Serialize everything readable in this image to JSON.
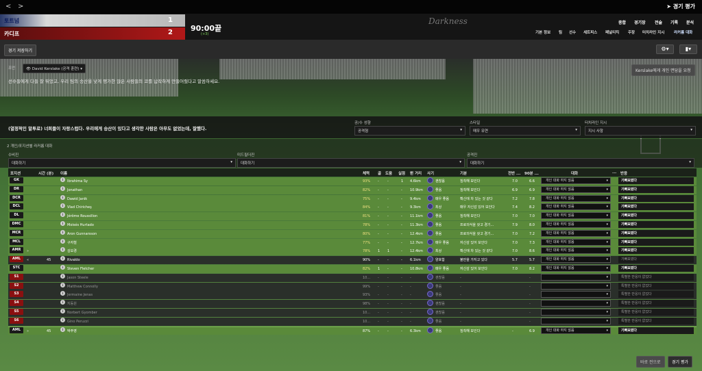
{
  "nav": {
    "back": "<",
    "forward": ">",
    "title": "경기 평가"
  },
  "teams": [
    {
      "name": "토트넘",
      "score": "1"
    },
    {
      "name": "카디프",
      "score": "2"
    }
  ],
  "match": {
    "time": "90:00끝",
    "added": "(+3)"
  },
  "logo": "Darkness",
  "menu": [
    "종합",
    "경기장",
    "전술",
    "기록",
    "분석"
  ],
  "submenu": [
    "기본 정보",
    "팀",
    "선수",
    "세트피스",
    "페널티킥",
    "주장",
    "터치라인 지시",
    "라커룸 대화"
  ],
  "save_btn": "경기 저장하기",
  "advisor": {
    "label": "조언",
    "name": "David Kerslake (공격 훈련)",
    "text": "선수들에게 다들 잘 뛰었고, 우리 팀의 승산을 낮게 평가한 많은 사람들의 코를 납작하게 만들어줬다고 말씀하세요.",
    "btn": "Kerslake에게 개인 면담을 요청"
  },
  "team_talk": {
    "text": "(열정적인 말투로) 너희들이 자랑스럽다. 우리에게 승산이 있다고 생각한 사람은 아무도 없었는데, 잘했다.",
    "attack_label": "공/수 성향",
    "attack_val": "공격형",
    "style_label": "스타일",
    "style_val": "매우 유연",
    "touch_label": "터치라인 지시",
    "touch_val": "지시 사항"
  },
  "section": {
    "title": "2  개인/포지션별 라커룸 대화",
    "def_label": "수비진",
    "def_val": "대화하기",
    "mid_label": "미드필더진",
    "mid_val": "대화하기",
    "att_label": "공격진",
    "att_val": "대화하기"
  },
  "columns": {
    "pos": "포지션",
    "time": "시간 (분)",
    "name": "이름",
    "cond": "체력",
    "g": "골",
    "a": "도움",
    "sh": "실점",
    "dist": "뛴 거리",
    "mor": "사기",
    "mood": "기분",
    "rbef": "전반 ...",
    "r90": "90분 ...",
    "talk": "대화",
    "dots": "...",
    "resp": "반응"
  },
  "rows": [
    {
      "pos": "GK",
      "t": "",
      "arrow": "",
      "name": "Ibrahima Sy",
      "cond": "93%",
      "g": "-",
      "a": "-",
      "sh": "1",
      "dist": "4.6km",
      "mor": "괜찮음",
      "mood": "침착해 보인다",
      "rb": "7.0",
      "r9": "6.6",
      "talk": "개인 대화 하지 않음",
      "resp": "기뻐보였다",
      "type": "g"
    },
    {
      "pos": "DR",
      "t": "",
      "arrow": "",
      "name": "Jonathan",
      "cond": "82%",
      "g": "-",
      "a": "-",
      "sh": "-",
      "dist": "10.9km",
      "mor": "좋음",
      "mood": "침착해 보인다",
      "rb": "6.9",
      "r9": "6.9",
      "talk": "개인 대화 하지 않음",
      "resp": "기뻐보였다",
      "type": "g"
    },
    {
      "pos": "DCR",
      "t": "",
      "arrow": "",
      "name": "Dawid Janik",
      "cond": "75%",
      "g": "-",
      "a": "-",
      "sh": "-",
      "dist": "9.4km",
      "mor": "매우 좋음",
      "mood": "확신에 차 있는 것 같다",
      "rb": "7.2",
      "r9": "7.8",
      "talk": "개인 대화 하지 않음",
      "resp": "기뻐보였다",
      "type": "g"
    },
    {
      "pos": "DCL",
      "t": "",
      "arrow": "",
      "name": "Vlad Chiricheş",
      "cond": "84%",
      "g": "-",
      "a": "-",
      "sh": "-",
      "dist": "9.3km",
      "mor": "최상",
      "mood": "매우 자신감 있어 보인다",
      "rb": "7.4",
      "r9": "8.2",
      "talk": "개인 대화 하지 않음",
      "resp": "기뻐보였다",
      "type": "g"
    },
    {
      "pos": "DL",
      "t": "",
      "arrow": "",
      "name": "Jérôme Roussillon",
      "cond": "81%",
      "g": "-",
      "a": "-",
      "sh": "-",
      "dist": "11.1km",
      "mor": "좋음",
      "mood": "침착해 보인다",
      "rb": "7.0",
      "r9": "7.0",
      "talk": "개인 대화 하지 않음",
      "resp": "기뻐보였다",
      "type": "g"
    },
    {
      "pos": "DMC",
      "t": "",
      "arrow": "",
      "name": "Moisés Hurtado",
      "cond": "78%",
      "g": "-",
      "a": "-",
      "sh": "-",
      "dist": "11.3km",
      "mor": "좋음",
      "mood": "프로의식을 갖고 경기...",
      "rb": "7.9",
      "r9": "8.0",
      "talk": "개인 대화 하지 않음",
      "resp": "기뻐보였다",
      "type": "g"
    },
    {
      "pos": "MCR",
      "t": "",
      "arrow": "",
      "name": "Aron Gunnarsson",
      "cond": "80%",
      "g": "-",
      "a": "-",
      "sh": "-",
      "dist": "12.4km",
      "mor": "좋음",
      "mood": "프로의식을 갖고 경기...",
      "rb": "7.0",
      "r9": "7.2",
      "talk": "개인 대화 하지 않음",
      "resp": "기뻐보였다",
      "type": "g"
    },
    {
      "pos": "MCL",
      "t": "",
      "arrow": "",
      "name": "구자철",
      "cond": "77%",
      "g": "-",
      "a": "-",
      "sh": "-",
      "dist": "12.7km",
      "mor": "매우 좋음",
      "mood": "자신감 있어 보인다",
      "rb": "7.0",
      "r9": "7.3",
      "talk": "개인 대화 하지 않음",
      "resp": "기뻐보였다",
      "type": "g"
    },
    {
      "pos": "AMR",
      "t": "",
      "arrow": "»",
      "name": "김보경",
      "cond": "78%",
      "g": "1",
      "a": "1",
      "sh": "-",
      "dist": "12.4km",
      "mor": "최상",
      "mood": "확신에 차 있는 것 같다",
      "rb": "7.0",
      "r9": "8.6",
      "talk": "개인 대화 하지 않음",
      "resp": "기뻐보였다",
      "type": "g"
    },
    {
      "pos": "AML",
      "t": "45",
      "arrow": "«",
      "name": "Rivaldo",
      "cond": "90%",
      "g": "-",
      "a": "-",
      "sh": "-",
      "dist": "6.1km",
      "mor": "양호함",
      "mood": "불만을 가지고 있다",
      "rb": "5.7",
      "r9": "5.7",
      "talk": "개인 대화 하지 않음",
      "resp": "기뻐보였다",
      "type": "d",
      "red": true
    },
    {
      "pos": "STC",
      "t": "",
      "arrow": "",
      "name": "Steven Fletcher",
      "cond": "82%",
      "g": "1",
      "a": "-",
      "sh": "-",
      "dist": "10.8km",
      "mor": "매우 좋음",
      "mood": "자신감 있어 보인다",
      "rb": "7.0",
      "r9": "8.2",
      "talk": "개인 대화 하지 않음",
      "resp": "기뻐보였다",
      "type": "g"
    },
    {
      "pos": "S1",
      "t": "",
      "arrow": "",
      "name": "Jason Steele",
      "cond": "10...",
      "g": "-",
      "a": "-",
      "sh": "-",
      "dist": "-",
      "mor": "괜찮음",
      "mood": "-",
      "rb": "",
      "r9": "-",
      "talk": "",
      "resp": "특별한 반응이 없었다",
      "type": "d",
      "red": true
    },
    {
      "pos": "S2",
      "t": "",
      "arrow": "",
      "name": "Matthew Connolly",
      "cond": "99%",
      "g": "-",
      "a": "-",
      "sh": "-",
      "dist": "-",
      "mor": "좋음",
      "mood": "-",
      "rb": "",
      "r9": "-",
      "talk": "",
      "resp": "특별한 반응이 없었다",
      "type": "d",
      "red": true
    },
    {
      "pos": "S3",
      "t": "",
      "arrow": "",
      "name": "Jermaine Jenas",
      "cond": "93%",
      "g": "-",
      "a": "-",
      "sh": "-",
      "dist": "-",
      "mor": "좋음",
      "mood": "-",
      "rb": "",
      "r9": "-",
      "talk": "",
      "resp": "특별한 반응이 없었다",
      "type": "d",
      "red": true
    },
    {
      "pos": "S4",
      "t": "",
      "arrow": "",
      "name": "지동원",
      "cond": "98%",
      "g": "-",
      "a": "-",
      "sh": "-",
      "dist": "-",
      "mor": "괜찮음",
      "mood": "-",
      "rb": "",
      "r9": "-",
      "talk": "",
      "resp": "특별한 반응이 없었다",
      "type": "d",
      "red": true
    },
    {
      "pos": "S5",
      "t": "",
      "arrow": "",
      "name": "Norbert Gyomber",
      "cond": "10...",
      "g": "-",
      "a": "-",
      "sh": "-",
      "dist": "-",
      "mor": "괜찮음",
      "mood": "-",
      "rb": "",
      "r9": "-",
      "talk": "",
      "resp": "특별한 반응이 없었다",
      "type": "d",
      "red": true
    },
    {
      "pos": "S6",
      "t": "",
      "arrow": "",
      "name": "Gino Peruzzi",
      "cond": "10...",
      "g": "-",
      "a": "-",
      "sh": "-",
      "dist": "-",
      "mor": "좋음",
      "mood": "-",
      "rb": "",
      "r9": "-",
      "talk": "",
      "resp": "특별한 반응이 없었다",
      "type": "d",
      "red": true
    },
    {
      "pos": "AML",
      "t": "45",
      "arrow": "»",
      "name": "박주영",
      "cond": "87%",
      "g": "-",
      "a": "-",
      "sh": "-",
      "dist": "6.3km",
      "mor": "좋음",
      "mood": "침착해 보인다",
      "rb": "-",
      "r9": "6.9",
      "talk": "개인 대화 하지 않음",
      "resp": "기뻐보였다",
      "type": "l"
    }
  ],
  "footer": {
    "replay": "바로 전으로",
    "rating": "경기 평가"
  }
}
